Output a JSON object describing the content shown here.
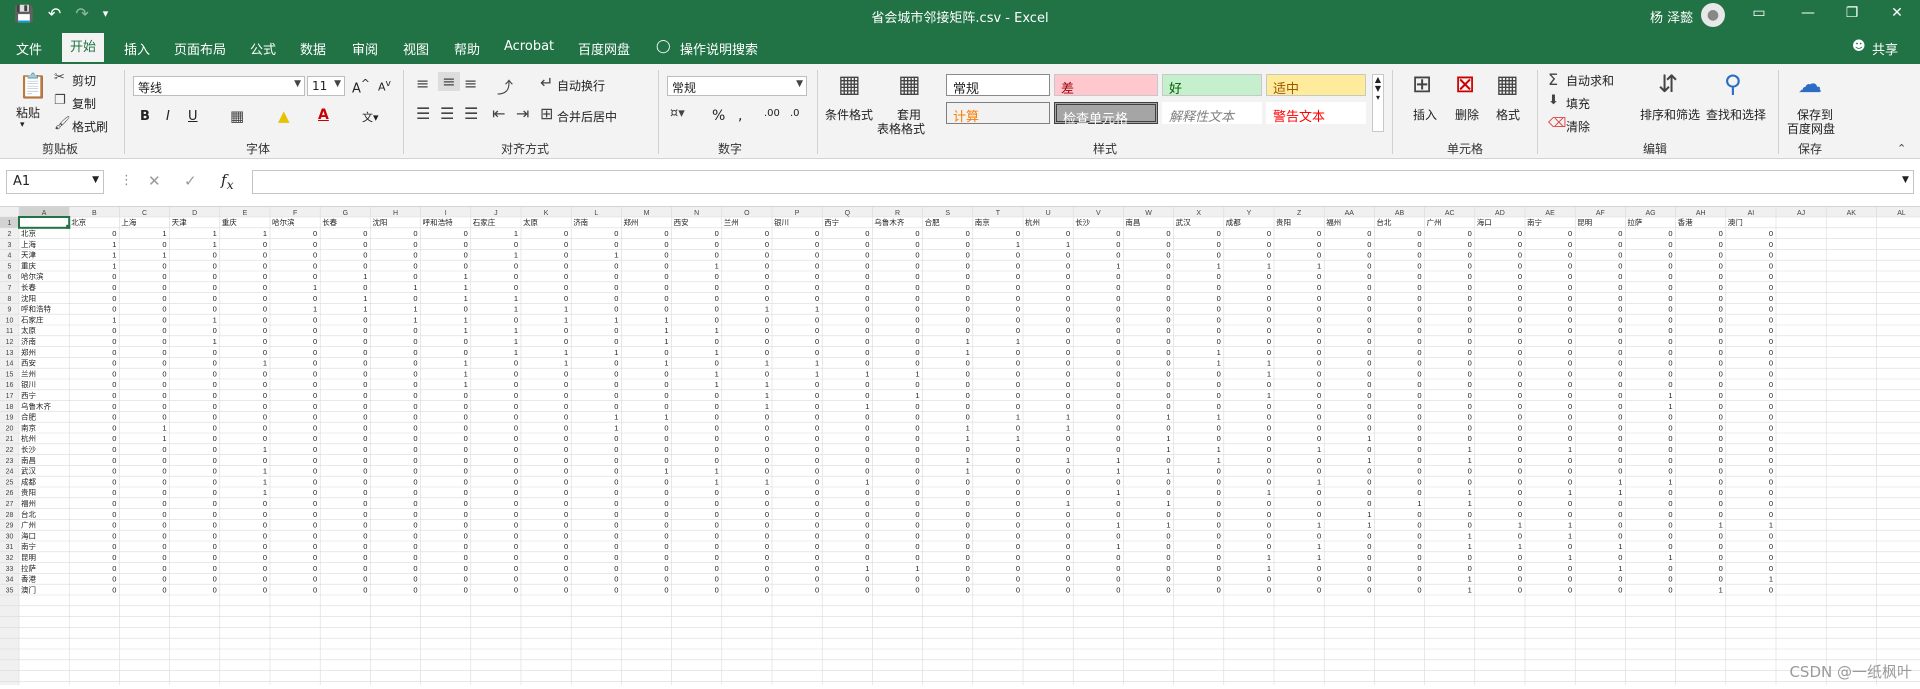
{
  "title": "省会城市邻接矩阵.csv  -  Excel",
  "user": "杨 泽懿",
  "tabs": [
    "文件",
    "开始",
    "插入",
    "页面布局",
    "公式",
    "数据",
    "审阅",
    "视图",
    "帮助",
    "Acrobat",
    "百度网盘",
    "操作说明搜索"
  ],
  "share": "共享",
  "clipboard": {
    "paste": "粘贴",
    "cut": "剪切",
    "copy": "复制",
    "format_painter": "格式刷",
    "label": "剪贴板"
  },
  "font": {
    "name": "等线",
    "size": "11",
    "label": "字体"
  },
  "alignment": {
    "wrap": "自动换行",
    "merge": "合并后居中",
    "label": "对齐方式"
  },
  "number": {
    "format": "常规",
    "label": "数字"
  },
  "styles": {
    "cond": "条件格式",
    "table": "套用",
    "table2": "表格格式",
    "normal": "常规",
    "bad": "差",
    "good": "好",
    "neutral": "适中",
    "calc": "计算",
    "check": "检查单元格",
    "explain": "解释性文本",
    "warn": "警告文本",
    "label": "样式"
  },
  "cells": {
    "insert": "插入",
    "delete": "删除",
    "format": "格式",
    "label": "单元格"
  },
  "editing": {
    "autosum": "自动求和",
    "fill": "填充",
    "clear": "清除",
    "sort": "排序和筛选",
    "find": "查找和选择",
    "label": "编辑"
  },
  "save": {
    "l1": "保存到",
    "l2": "百度网盘",
    "label": "保存"
  },
  "namebox": "A1",
  "formula": "",
  "columns": [
    "A",
    "B",
    "C",
    "D",
    "E",
    "F",
    "G",
    "H",
    "I",
    "J",
    "K",
    "L",
    "M",
    "N",
    "O",
    "P",
    "Q",
    "R",
    "S",
    "T",
    "U",
    "V",
    "W",
    "X",
    "Y",
    "Z",
    "AA",
    "AB",
    "AC",
    "AD",
    "AE",
    "AF",
    "AG",
    "AH",
    "AI",
    "AJ",
    "AK",
    "AL"
  ],
  "cities": [
    "北京",
    "上海",
    "天津",
    "重庆",
    "哈尔滨",
    "长春",
    "沈阳",
    "呼和浩特",
    "石家庄",
    "太原",
    "济南",
    "郑州",
    "西安",
    "兰州",
    "银川",
    "西宁",
    "乌鲁木齐",
    "合肥",
    "南京",
    "杭州",
    "长沙",
    "南昌",
    "武汉",
    "成都",
    "贵阳",
    "福州",
    "台北",
    "广州",
    "海口",
    "南宁",
    "昆明",
    "拉萨",
    "香港",
    "澳门"
  ],
  "watermark": "CSDN @一纸枫叶",
  "matrix": [
    [
      0,
      1,
      1,
      1,
      0,
      0,
      0,
      0,
      1,
      0,
      0,
      0,
      0,
      0,
      0,
      0,
      0,
      0,
      0,
      0,
      0,
      0,
      0,
      0,
      0,
      0,
      0,
      0,
      0,
      0,
      0,
      0,
      0,
      0
    ],
    [
      1,
      0,
      1,
      0,
      0,
      0,
      0,
      0,
      0,
      0,
      0,
      0,
      0,
      0,
      0,
      0,
      0,
      0,
      1,
      1,
      0,
      0,
      0,
      0,
      0,
      0,
      0,
      0,
      0,
      0,
      0,
      0,
      0,
      0
    ],
    [
      1,
      1,
      0,
      0,
      0,
      0,
      0,
      0,
      1,
      0,
      1,
      0,
      0,
      0,
      0,
      0,
      0,
      0,
      0,
      0,
      0,
      0,
      0,
      0,
      0,
      0,
      0,
      0,
      0,
      0,
      0,
      0,
      0,
      0
    ],
    [
      1,
      0,
      0,
      0,
      0,
      0,
      0,
      0,
      0,
      0,
      0,
      0,
      1,
      0,
      0,
      0,
      0,
      0,
      0,
      0,
      1,
      0,
      1,
      1,
      1,
      0,
      0,
      0,
      0,
      0,
      0,
      0,
      0,
      0
    ],
    [
      0,
      0,
      0,
      0,
      0,
      1,
      0,
      1,
      0,
      0,
      0,
      0,
      0,
      0,
      0,
      0,
      0,
      0,
      0,
      0,
      0,
      0,
      0,
      0,
      0,
      0,
      0,
      0,
      0,
      0,
      0,
      0,
      0,
      0
    ],
    [
      0,
      0,
      0,
      0,
      1,
      0,
      1,
      1,
      0,
      0,
      0,
      0,
      0,
      0,
      0,
      0,
      0,
      0,
      0,
      0,
      0,
      0,
      0,
      0,
      0,
      0,
      0,
      0,
      0,
      0,
      0,
      0,
      0,
      0
    ],
    [
      0,
      0,
      0,
      0,
      0,
      1,
      0,
      1,
      1,
      0,
      0,
      0,
      0,
      0,
      0,
      0,
      0,
      0,
      0,
      0,
      0,
      0,
      0,
      0,
      0,
      0,
      0,
      0,
      0,
      0,
      0,
      0,
      0,
      0
    ],
    [
      0,
      0,
      0,
      0,
      1,
      1,
      1,
      0,
      1,
      1,
      0,
      0,
      0,
      1,
      1,
      0,
      0,
      0,
      0,
      0,
      0,
      0,
      0,
      0,
      0,
      0,
      0,
      0,
      0,
      0,
      0,
      0,
      0,
      0
    ],
    [
      1,
      0,
      1,
      0,
      0,
      0,
      1,
      1,
      0,
      1,
      1,
      1,
      0,
      0,
      0,
      0,
      0,
      0,
      0,
      0,
      0,
      0,
      0,
      0,
      0,
      0,
      0,
      0,
      0,
      0,
      0,
      0,
      0,
      0
    ],
    [
      0,
      0,
      0,
      0,
      0,
      0,
      0,
      1,
      1,
      0,
      0,
      1,
      1,
      0,
      0,
      0,
      0,
      0,
      0,
      0,
      0,
      0,
      0,
      0,
      0,
      0,
      0,
      0,
      0,
      0,
      0,
      0,
      0,
      0
    ],
    [
      0,
      0,
      1,
      0,
      0,
      0,
      0,
      0,
      1,
      0,
      0,
      1,
      0,
      0,
      0,
      0,
      0,
      1,
      1,
      0,
      0,
      0,
      0,
      0,
      0,
      0,
      0,
      0,
      0,
      0,
      0,
      0,
      0,
      0
    ],
    [
      0,
      0,
      0,
      0,
      0,
      0,
      0,
      0,
      1,
      1,
      1,
      0,
      1,
      0,
      0,
      0,
      0,
      1,
      0,
      0,
      0,
      0,
      1,
      0,
      0,
      0,
      0,
      0,
      0,
      0,
      0,
      0,
      0,
      0
    ],
    [
      0,
      0,
      0,
      1,
      0,
      0,
      0,
      1,
      0,
      1,
      0,
      1,
      0,
      1,
      1,
      0,
      0,
      0,
      0,
      0,
      0,
      0,
      1,
      1,
      0,
      0,
      0,
      0,
      0,
      0,
      0,
      0,
      0,
      0
    ],
    [
      0,
      0,
      0,
      0,
      0,
      0,
      0,
      1,
      0,
      0,
      0,
      0,
      1,
      0,
      1,
      1,
      1,
      0,
      0,
      0,
      0,
      0,
      0,
      1,
      0,
      0,
      0,
      0,
      0,
      0,
      0,
      0,
      0,
      0
    ],
    [
      0,
      0,
      0,
      0,
      0,
      0,
      0,
      1,
      0,
      0,
      0,
      0,
      1,
      1,
      0,
      0,
      0,
      0,
      0,
      0,
      0,
      0,
      0,
      0,
      0,
      0,
      0,
      0,
      0,
      0,
      0,
      0,
      0,
      0
    ],
    [
      0,
      0,
      0,
      0,
      0,
      0,
      0,
      0,
      0,
      0,
      0,
      0,
      0,
      1,
      0,
      0,
      1,
      0,
      0,
      0,
      0,
      0,
      0,
      1,
      0,
      0,
      0,
      0,
      0,
      0,
      0,
      1,
      0,
      0
    ],
    [
      0,
      0,
      0,
      0,
      0,
      0,
      0,
      0,
      0,
      0,
      0,
      0,
      0,
      1,
      0,
      1,
      0,
      0,
      0,
      0,
      0,
      0,
      0,
      0,
      0,
      0,
      0,
      0,
      0,
      0,
      0,
      1,
      0,
      0
    ],
    [
      0,
      0,
      0,
      0,
      0,
      0,
      0,
      0,
      0,
      0,
      1,
      1,
      0,
      0,
      0,
      0,
      0,
      0,
      1,
      1,
      0,
      1,
      1,
      0,
      0,
      0,
      0,
      0,
      0,
      0,
      0,
      0,
      0,
      0
    ],
    [
      0,
      1,
      0,
      0,
      0,
      0,
      0,
      0,
      0,
      0,
      1,
      0,
      0,
      0,
      0,
      0,
      0,
      1,
      0,
      1,
      0,
      0,
      0,
      0,
      0,
      0,
      0,
      0,
      0,
      0,
      0,
      0,
      0,
      0
    ],
    [
      0,
      1,
      0,
      0,
      0,
      0,
      0,
      0,
      0,
      0,
      0,
      0,
      0,
      0,
      0,
      0,
      0,
      1,
      1,
      0,
      0,
      1,
      0,
      0,
      0,
      1,
      0,
      0,
      0,
      0,
      0,
      0,
      0,
      0
    ],
    [
      0,
      0,
      0,
      1,
      0,
      0,
      0,
      0,
      0,
      0,
      0,
      0,
      0,
      0,
      0,
      0,
      0,
      0,
      0,
      0,
      0,
      1,
      1,
      0,
      1,
      0,
      0,
      1,
      0,
      1,
      0,
      0,
      0,
      0
    ],
    [
      0,
      0,
      0,
      0,
      0,
      0,
      0,
      0,
      0,
      0,
      0,
      0,
      0,
      0,
      0,
      0,
      0,
      1,
      0,
      1,
      1,
      0,
      1,
      0,
      0,
      1,
      0,
      1,
      0,
      0,
      0,
      0,
      0,
      0
    ],
    [
      0,
      0,
      0,
      1,
      0,
      0,
      0,
      0,
      0,
      0,
      0,
      1,
      1,
      0,
      0,
      0,
      0,
      1,
      0,
      0,
      1,
      1,
      0,
      0,
      0,
      0,
      0,
      0,
      0,
      0,
      0,
      0,
      0,
      0
    ],
    [
      0,
      0,
      0,
      1,
      0,
      0,
      0,
      0,
      0,
      0,
      0,
      0,
      1,
      1,
      0,
      1,
      0,
      0,
      0,
      0,
      0,
      0,
      0,
      0,
      1,
      0,
      0,
      0,
      0,
      0,
      1,
      1,
      0,
      0
    ],
    [
      0,
      0,
      0,
      1,
      0,
      0,
      0,
      0,
      0,
      0,
      0,
      0,
      0,
      0,
      0,
      0,
      0,
      0,
      0,
      0,
      1,
      0,
      0,
      1,
      0,
      0,
      0,
      1,
      0,
      1,
      1,
      0,
      0,
      0
    ],
    [
      0,
      0,
      0,
      0,
      0,
      0,
      0,
      0,
      0,
      0,
      0,
      0,
      0,
      0,
      0,
      0,
      0,
      0,
      0,
      1,
      0,
      1,
      0,
      0,
      0,
      0,
      1,
      1,
      0,
      0,
      0,
      0,
      0,
      0
    ],
    [
      0,
      0,
      0,
      0,
      0,
      0,
      0,
      0,
      0,
      0,
      0,
      0,
      0,
      0,
      0,
      0,
      0,
      0,
      0,
      0,
      0,
      0,
      0,
      0,
      0,
      1,
      0,
      0,
      0,
      0,
      0,
      0,
      0,
      0
    ],
    [
      0,
      0,
      0,
      0,
      0,
      0,
      0,
      0,
      0,
      0,
      0,
      0,
      0,
      0,
      0,
      0,
      0,
      0,
      0,
      0,
      1,
      1,
      0,
      0,
      1,
      1,
      0,
      0,
      1,
      1,
      0,
      0,
      1,
      1
    ],
    [
      0,
      0,
      0,
      0,
      0,
      0,
      0,
      0,
      0,
      0,
      0,
      0,
      0,
      0,
      0,
      0,
      0,
      0,
      0,
      0,
      0,
      0,
      0,
      0,
      0,
      0,
      0,
      1,
      0,
      1,
      0,
      0,
      0,
      0
    ],
    [
      0,
      0,
      0,
      0,
      0,
      0,
      0,
      0,
      0,
      0,
      0,
      0,
      0,
      0,
      0,
      0,
      0,
      0,
      0,
      0,
      1,
      0,
      0,
      0,
      1,
      0,
      0,
      1,
      1,
      0,
      1,
      0,
      0,
      0
    ],
    [
      0,
      0,
      0,
      0,
      0,
      0,
      0,
      0,
      0,
      0,
      0,
      0,
      0,
      0,
      0,
      0,
      0,
      0,
      0,
      0,
      0,
      0,
      0,
      1,
      1,
      0,
      0,
      0,
      0,
      1,
      0,
      1,
      0,
      0
    ],
    [
      0,
      0,
      0,
      0,
      0,
      0,
      0,
      0,
      0,
      0,
      0,
      0,
      0,
      0,
      0,
      1,
      1,
      0,
      0,
      0,
      0,
      0,
      0,
      1,
      0,
      0,
      0,
      0,
      0,
      0,
      1,
      0,
      0,
      0
    ],
    [
      0,
      0,
      0,
      0,
      0,
      0,
      0,
      0,
      0,
      0,
      0,
      0,
      0,
      0,
      0,
      0,
      0,
      0,
      0,
      0,
      0,
      0,
      0,
      0,
      0,
      0,
      0,
      1,
      0,
      0,
      0,
      0,
      0,
      1
    ],
    [
      0,
      0,
      0,
      0,
      0,
      0,
      0,
      0,
      0,
      0,
      0,
      0,
      0,
      0,
      0,
      0,
      0,
      0,
      0,
      0,
      0,
      0,
      0,
      0,
      0,
      0,
      0,
      1,
      0,
      0,
      0,
      0,
      1,
      0
    ]
  ]
}
